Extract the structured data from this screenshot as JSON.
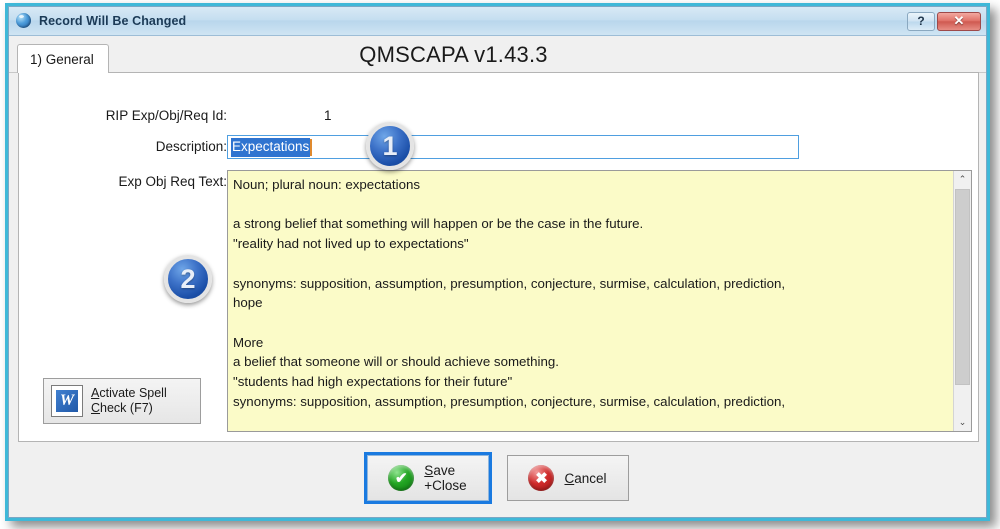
{
  "window": {
    "title": "Record Will Be Changed",
    "icon": "globe-icon",
    "help_button": "?",
    "close_button": "✕",
    "border_color": "#3fb8d8",
    "titlebar_color": "#c5def0"
  },
  "tabs": [
    {
      "label": "1) General",
      "active": true
    }
  ],
  "app_title": "QMSCAPA v1.43.3",
  "form": {
    "id_field": {
      "label": "RIP Exp/Obj/Req Id:",
      "value": "1"
    },
    "description_field": {
      "label": "Description:",
      "value": "Expectations",
      "selected": true,
      "selection_color": "#2f74d0",
      "caret_color": "#e08a2e",
      "border_color": "#4f9fe0"
    },
    "memo_field": {
      "label": "Exp Obj Req Text:",
      "background_color": "#fbfbc8",
      "value": "Noun; plural noun: expectations\n\na strong belief that something will happen or be the case in the future.\n\"reality had not lived up to expectations\"\n\nsynonyms: supposition, assumption, presumption, conjecture, surmise, calculation, prediction,\nhope\n\nMore\na belief that someone will or should achieve something.\n\"students had high expectations for their future\"\nsynonyms: supposition, assumption, presumption, conjecture, surmise, calculation, prediction,",
      "scrollbar": {
        "up_arrow": "⌃",
        "down_arrow": "⌄"
      }
    }
  },
  "spell_button": {
    "line1_pre": "",
    "line1_acc": "A",
    "line1_post": "ctivate Spell",
    "line2_acc": "C",
    "line2_post": "heck (F7)",
    "icon": "word-icon",
    "icon_letter": "W"
  },
  "buttons": {
    "save": {
      "icon": "green-check-icon",
      "icon_glyph": "✔",
      "line1_acc": "S",
      "line1_post": "ave",
      "line2": "+Close",
      "focused": true
    },
    "cancel": {
      "icon": "red-x-icon",
      "icon_glyph": "✖",
      "label_acc": "C",
      "label_post": "ancel",
      "focused": false
    }
  },
  "callouts": [
    {
      "number": "1",
      "target": "description-field"
    },
    {
      "number": "2",
      "target": "memo-field"
    }
  ]
}
